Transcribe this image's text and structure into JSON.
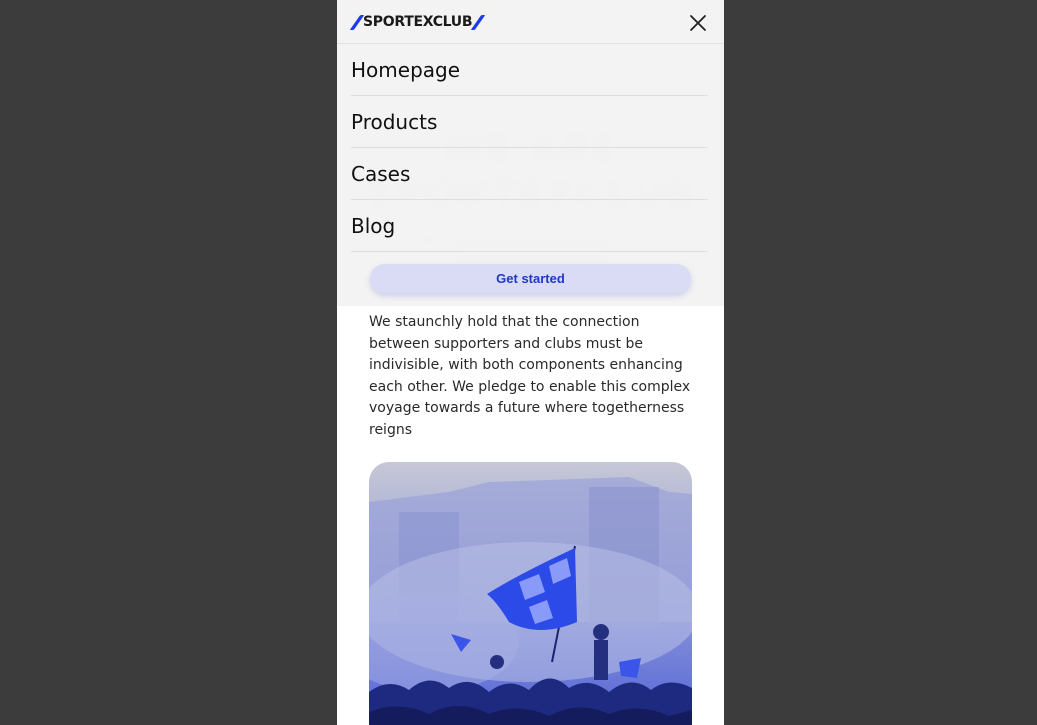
{
  "brand": {
    "logo_text": "SPORTEXCLUB",
    "accent_color": "#1d3be8"
  },
  "hero": {
    "heading": "WE ARE SPORTEXCLUB"
  },
  "menu": {
    "close_icon": "close-icon",
    "items": [
      {
        "label": "Homepage"
      },
      {
        "label": "Products"
      },
      {
        "label": "Cases"
      },
      {
        "label": "Blog"
      }
    ],
    "cta_label": "Get started"
  },
  "content": {
    "paragraph": "We staunchly hold that the connection between supporters and clubs must be indivisible, with both components enhancing each other. We pledge to enable this complex voyage towards a future where togetherness reigns",
    "image": {
      "subject": "fans-waving-checkered-flag",
      "tint_color": "#2a3fe0"
    }
  }
}
